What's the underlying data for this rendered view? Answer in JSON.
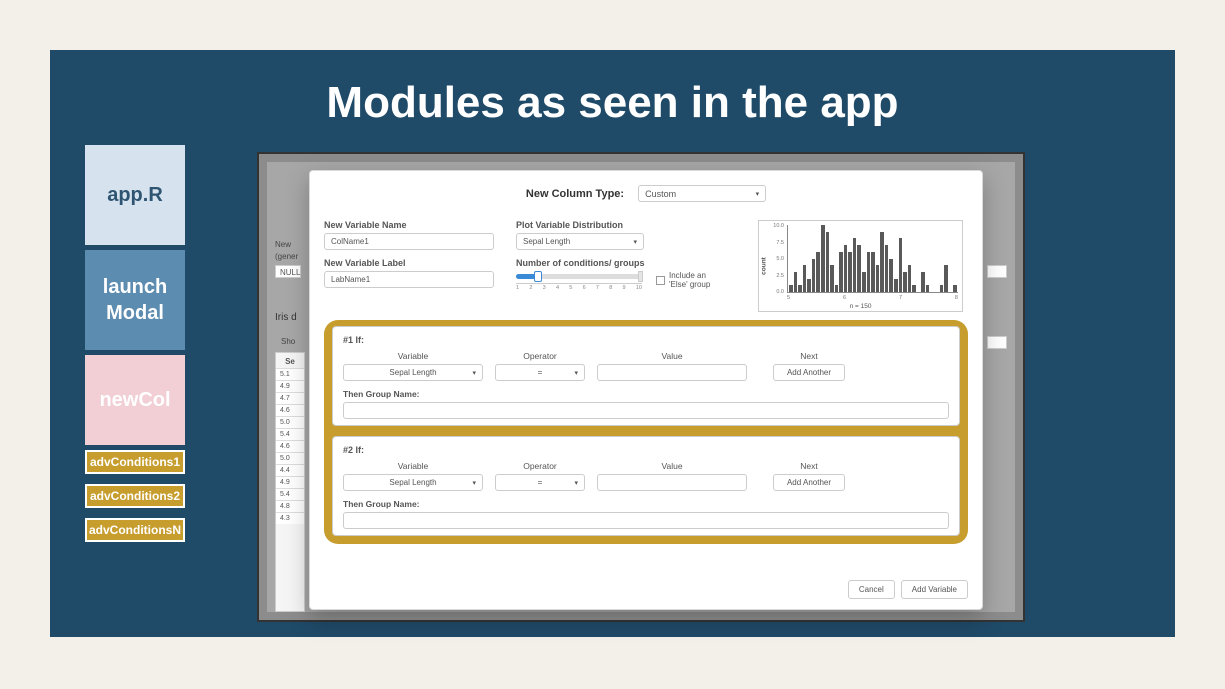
{
  "slide": {
    "title": "Modules as seen in the app"
  },
  "sidebar_tiles": {
    "app": "app.R",
    "modal": "launch Modal",
    "newcol": "newCol",
    "adv": [
      "advConditions1",
      "advConditions2",
      "advConditionsN"
    ]
  },
  "background": {
    "left_label_1": "New",
    "left_label_2": "(gener",
    "null_chip": "NULL",
    "iris_label": "Iris d",
    "show_label": "Sho",
    "col_header": "Se",
    "row_values": [
      "5.1",
      "4.9",
      "4.7",
      "4.6",
      "5.0",
      "5.4",
      "4.6",
      "5.0",
      "4.4",
      "4.9",
      "5.4",
      "4.8",
      "4.3"
    ],
    "right_chip": ""
  },
  "modal": {
    "header_label": "New Column Type:",
    "header_select": "Custom",
    "new_var_name_label": "New Variable Name",
    "new_var_name_value": "ColName1",
    "new_var_label_label": "New Variable Label",
    "new_var_label_value": "LabName1",
    "plot_var_label": "Plot Variable Distribution",
    "plot_var_value": "Sepal Length",
    "num_cond_label": "Number of conditions/ groups",
    "else_label": "Include an 'Else' group",
    "slider_ticks": [
      "1",
      "2",
      "3",
      "4",
      "5",
      "6",
      "7",
      "8",
      "9",
      "10"
    ],
    "slider_end": "10",
    "chart_n": "n = 150",
    "cond_headers": {
      "variable": "Variable",
      "operator": "Operator",
      "value": "Value",
      "next": "Next"
    },
    "cond1": {
      "title": "#1 If:",
      "variable": "Sepal Length",
      "operator": "=",
      "value": "",
      "next": "Add Another",
      "group_label": "Then Group Name:"
    },
    "cond2": {
      "title": "#2 If:",
      "variable": "Sepal Length",
      "operator": "=",
      "value": "",
      "next": "Add Another",
      "group_label": "Then Group Name:"
    },
    "footer": {
      "cancel": "Cancel",
      "add": "Add Variable"
    }
  },
  "chart_data": {
    "type": "bar",
    "title": "",
    "xlabel": "",
    "ylabel": "count",
    "note": "n = 150",
    "x_ticks": [
      5,
      6,
      7,
      8
    ],
    "y_ticks": [
      0.0,
      2.5,
      5.0,
      7.5,
      10.0
    ],
    "ylim": [
      0,
      10
    ],
    "categories_approx_bin_left_edge": [
      4.3,
      4.4,
      4.5,
      4.6,
      4.7,
      4.8,
      4.9,
      5.0,
      5.1,
      5.2,
      5.3,
      5.4,
      5.5,
      5.6,
      5.7,
      5.8,
      5.9,
      6.0,
      6.1,
      6.2,
      6.3,
      6.4,
      6.5,
      6.6,
      6.7,
      6.8,
      6.9,
      7.0,
      7.1,
      7.2,
      7.3,
      7.4,
      7.5,
      7.6,
      7.7,
      7.8,
      7.9
    ],
    "values": [
      1,
      3,
      1,
      4,
      2,
      5,
      6,
      10,
      9,
      4,
      1,
      6,
      7,
      6,
      8,
      7,
      3,
      6,
      6,
      4,
      9,
      7,
      5,
      2,
      8,
      3,
      4,
      1,
      0,
      3,
      1,
      0,
      0,
      1,
      4,
      0,
      1
    ]
  }
}
